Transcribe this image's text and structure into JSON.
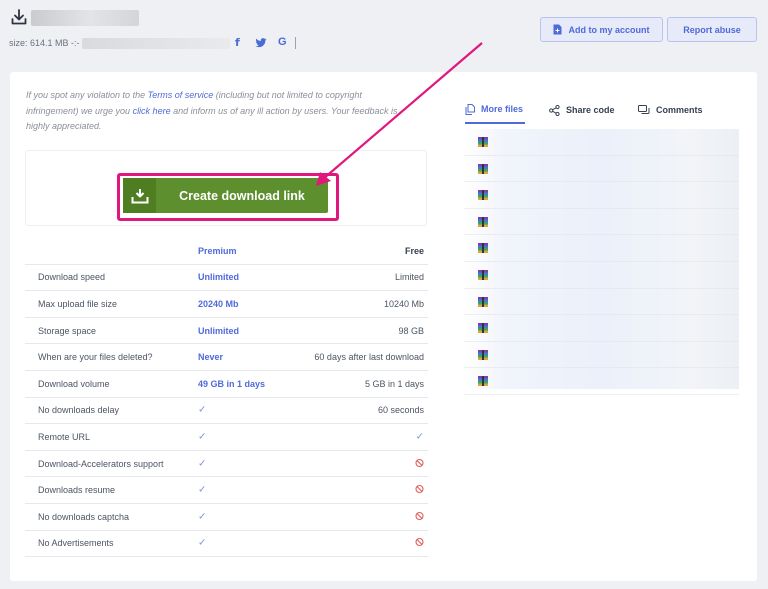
{
  "header": {
    "download_icon": "download-icon",
    "size_label": "size: 614.1 MB -:-",
    "social": {
      "facebook": "f",
      "twitter": "twitter-icon",
      "google": "G"
    }
  },
  "actions": {
    "add_account": "Add to my account",
    "report_abuse": "Report abuse"
  },
  "notice": {
    "part1": "If you spot any violation to the ",
    "terms_link": "Terms of service",
    "part2": " (including but not limited to copyright infringement) we urge you ",
    "click_link": "click here",
    "part3": " and inform us of any ill action by users. Your feedback is highly appreciated."
  },
  "download": {
    "button_label": "Create download link",
    "highlight_color": "#e0177d",
    "button_color": "#5e8f2e"
  },
  "comparison": {
    "headers": {
      "premium": "Premium",
      "free": "Free"
    },
    "rows": [
      {
        "feature": "Download speed",
        "premium": "Unlimited",
        "free": "Limited"
      },
      {
        "feature": "Max upload file size",
        "premium": "20240 Mb",
        "free": "10240 Mb"
      },
      {
        "feature": "Storage space",
        "premium": "Unlimited",
        "free": "98 GB"
      },
      {
        "feature": "When are your files deleted?",
        "premium": "Never",
        "free": "60 days after last download"
      },
      {
        "feature": "Download volume",
        "premium": "49 GB in 1 days",
        "free": "5 GB in 1 days"
      },
      {
        "feature": "No downloads delay",
        "premium": "✓",
        "free": "60 seconds"
      },
      {
        "feature": "Remote URL",
        "premium": "✓",
        "free": "✓"
      },
      {
        "feature": "Download-Accelerators support",
        "premium": "✓",
        "free": "no"
      },
      {
        "feature": "Downloads resume",
        "premium": "✓",
        "free": "no"
      },
      {
        "feature": "No downloads captcha",
        "premium": "✓",
        "free": "no"
      },
      {
        "feature": "No Advertisements",
        "premium": "✓",
        "free": "no"
      }
    ]
  },
  "sidebar": {
    "tabs": [
      {
        "label": "More files",
        "icon": "files-icon",
        "active": true
      },
      {
        "label": "Share code",
        "icon": "share-icon",
        "active": false
      },
      {
        "label": "Comments",
        "icon": "comment-icon",
        "active": false
      }
    ],
    "file_icon": "archive-icon"
  },
  "colors": {
    "accent": "#4f6ad9",
    "annotation": "#e0177d",
    "success": "#5e8f2e",
    "danger": "#e25b5b"
  }
}
